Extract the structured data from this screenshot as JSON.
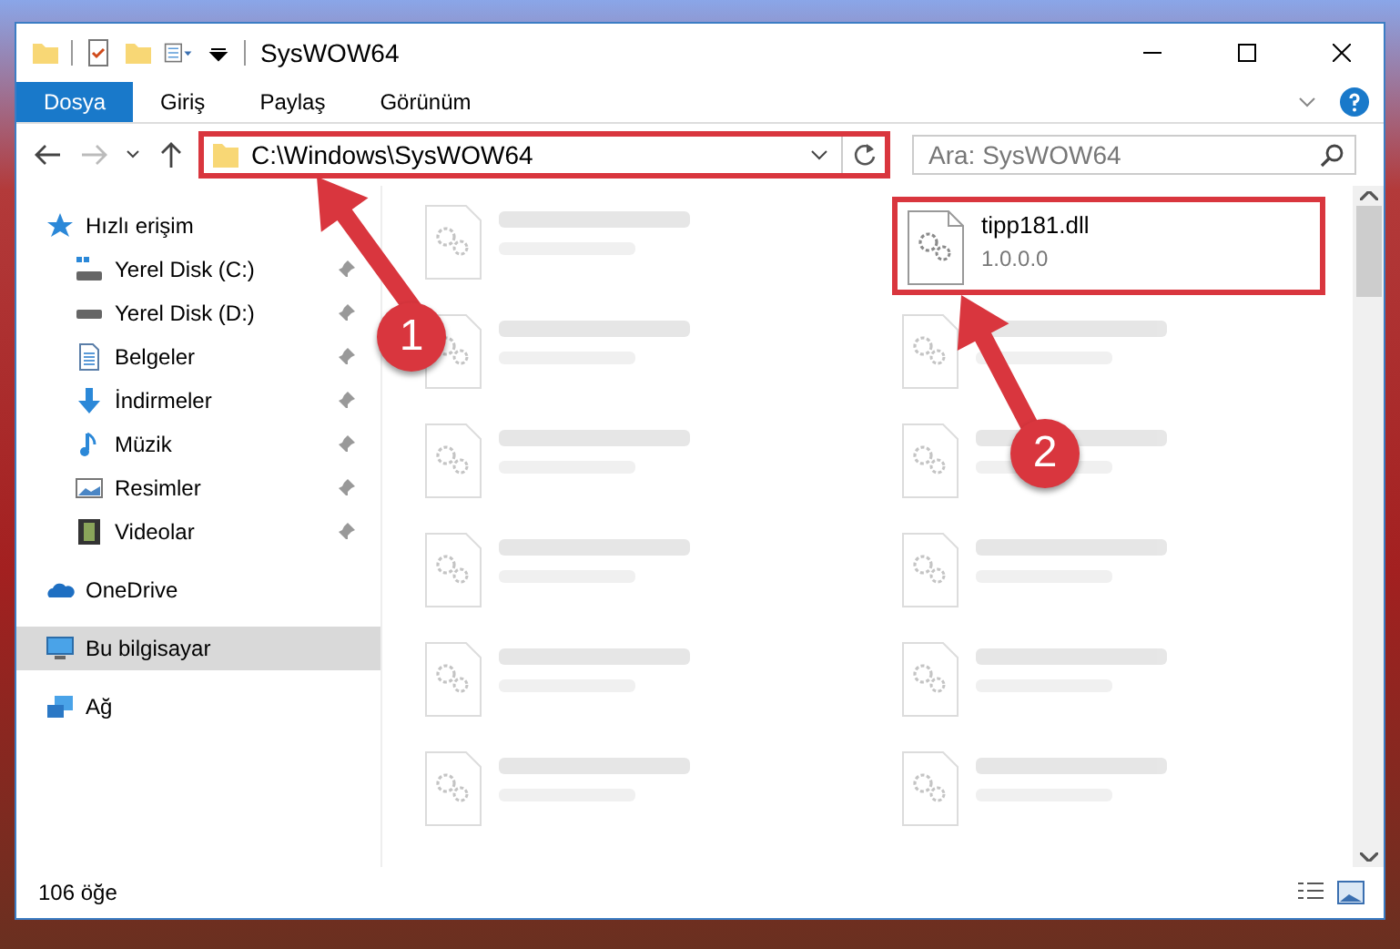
{
  "window": {
    "title": "SysWOW64"
  },
  "ribbon": {
    "tabs": [
      {
        "label": "Dosya",
        "selected": true
      },
      {
        "label": "Giriş",
        "selected": false
      },
      {
        "label": "Paylaş",
        "selected": false
      },
      {
        "label": "Görünüm",
        "selected": false
      }
    ]
  },
  "address_bar": {
    "path": "C:\\Windows\\SysWOW64",
    "highlighted": true
  },
  "search": {
    "placeholder": "Ara: SysWOW64"
  },
  "sidebar": {
    "items": [
      {
        "label": "Hızlı erişim",
        "kind": "star",
        "selected": false,
        "children": [
          {
            "label": "Yerel Disk (C:)",
            "kind": "drive-c",
            "pinned": true,
            "selected": false
          },
          {
            "label": "Yerel Disk (D:)",
            "kind": "drive",
            "pinned": true,
            "selected": false
          },
          {
            "label": "Belgeler",
            "kind": "docs",
            "pinned": true,
            "selected": false
          },
          {
            "label": "İndirmeler",
            "kind": "download",
            "pinned": true,
            "selected": false
          },
          {
            "label": "Müzik",
            "kind": "music",
            "pinned": true,
            "selected": false
          },
          {
            "label": "Resimler",
            "kind": "pictures",
            "pinned": true,
            "selected": false
          },
          {
            "label": "Videolar",
            "kind": "videos",
            "pinned": true,
            "selected": false
          }
        ]
      },
      {
        "label": "OneDrive",
        "kind": "cloud",
        "selected": false
      },
      {
        "label": "Bu bilgisayar",
        "kind": "pc",
        "selected": true
      },
      {
        "label": "Ağ",
        "kind": "network",
        "selected": false
      }
    ]
  },
  "files": [
    {
      "kind": "blurred",
      "highlighted": false
    },
    {
      "kind": "file",
      "name": "tipp181.dll",
      "detail": "1.0.0.0",
      "highlighted": true
    },
    {
      "kind": "blurred",
      "highlighted": false
    },
    {
      "kind": "blurred",
      "highlighted": false
    },
    {
      "kind": "blurred",
      "highlighted": false
    },
    {
      "kind": "blurred",
      "highlighted": false
    },
    {
      "kind": "blurred",
      "highlighted": false
    },
    {
      "kind": "blurred",
      "highlighted": false
    },
    {
      "kind": "blurred",
      "highlighted": false
    },
    {
      "kind": "blurred",
      "highlighted": false
    },
    {
      "kind": "blurred",
      "highlighted": false
    },
    {
      "kind": "blurred",
      "highlighted": false
    }
  ],
  "status_bar": {
    "count": "106 öğe"
  },
  "annotations": [
    {
      "number": "1"
    },
    {
      "number": "2"
    }
  ]
}
